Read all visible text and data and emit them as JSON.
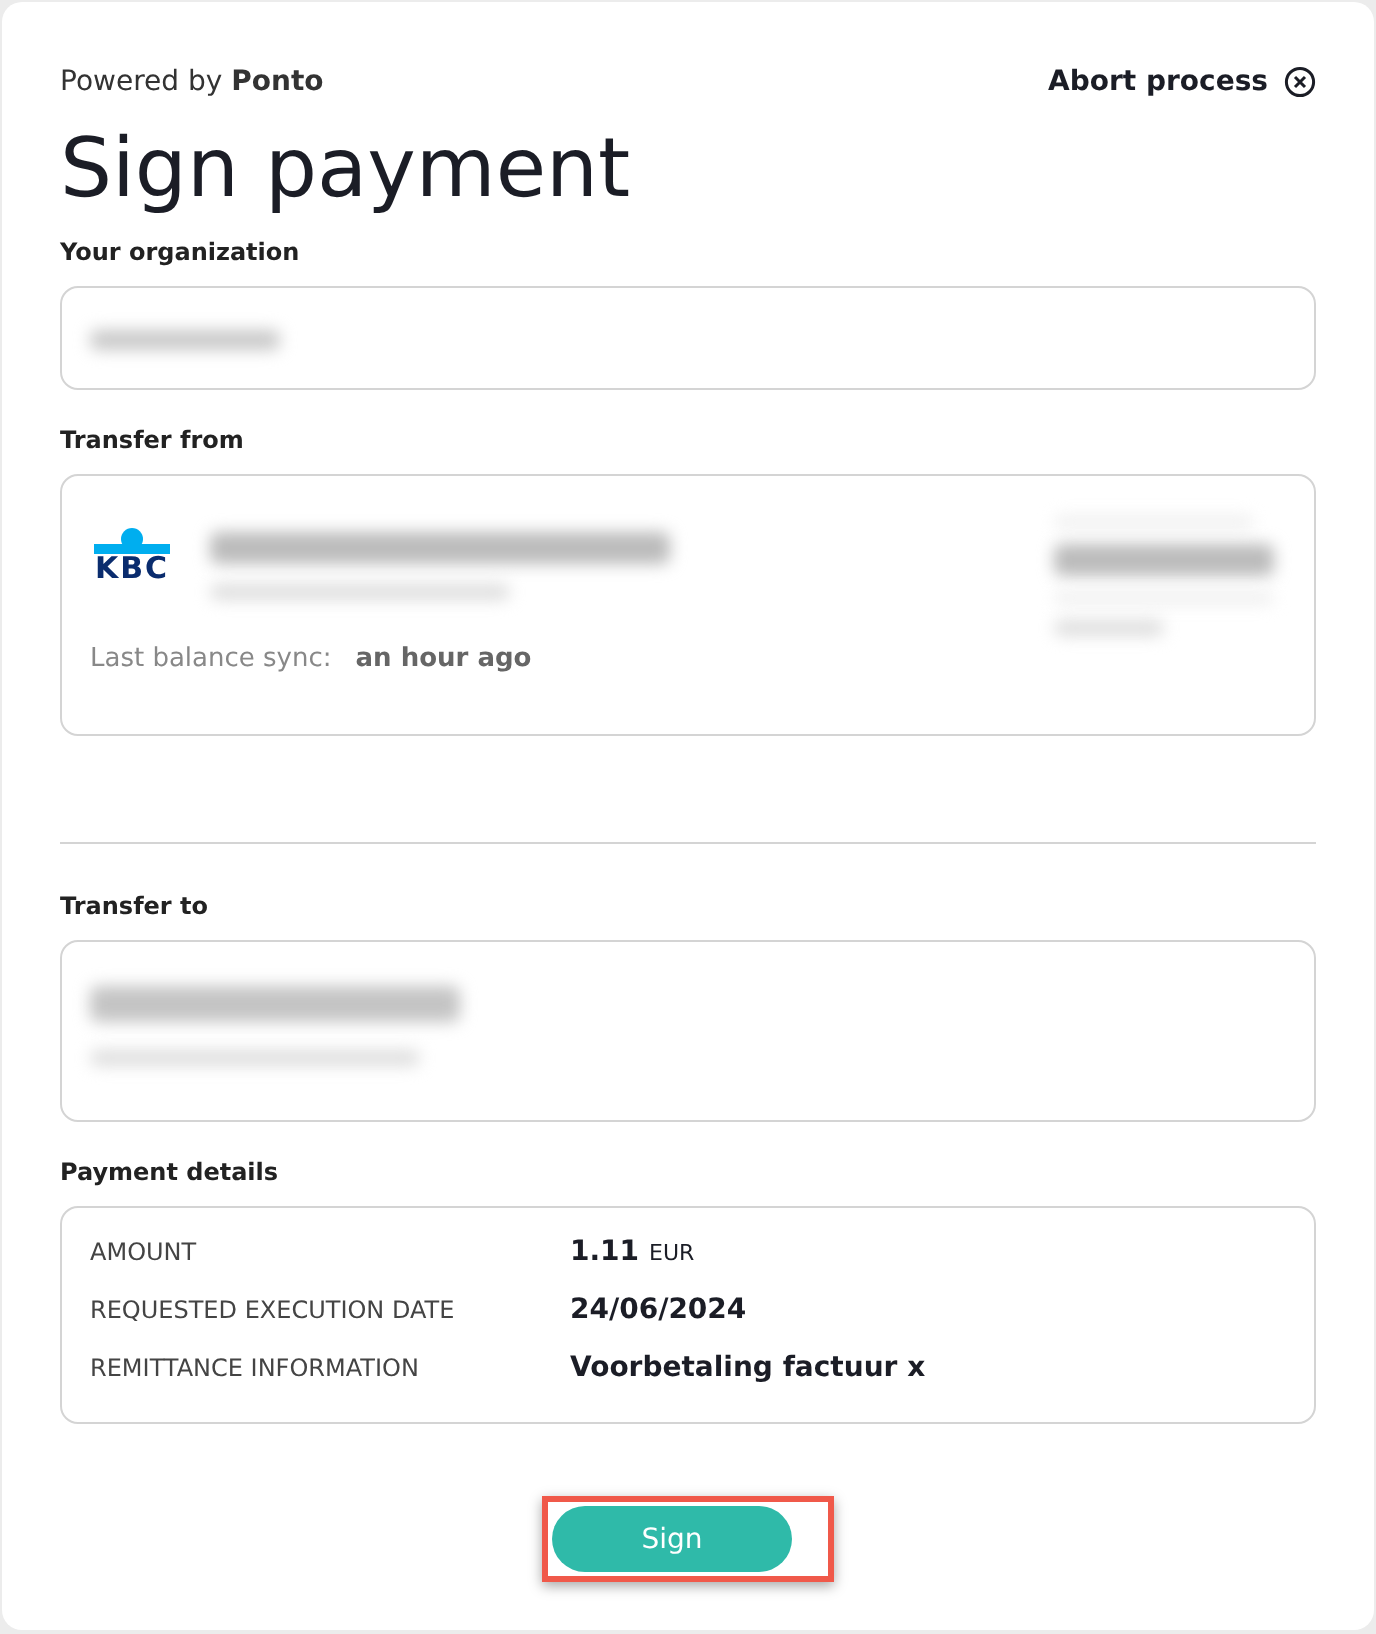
{
  "header": {
    "powered_by": "Powered by **Ponto**",
    "abort": "Abort process"
  },
  "title": "Sign payment",
  "organization": {
    "label": "Your organization"
  },
  "transfer_from": {
    "label": "Transfer from",
    "bank_logo": "KBC",
    "sync_label": "Last balance sync:",
    "sync_value": "an hour ago"
  },
  "transfer_to": {
    "label": "Transfer to"
  },
  "payment_details": {
    "label": "Payment details",
    "rows": [
      {
        "label": "AMOUNT",
        "value": "1.11",
        "unit": "EUR"
      },
      {
        "label": "REQUESTED EXECUTION DATE",
        "value": "24/06/2024"
      },
      {
        "label": "REMITTANCE INFORMATION",
        "value": "Voorbetaling factuur x"
      }
    ]
  },
  "sign_button": {
    "label": "Sign",
    "highlighted": true
  }
}
